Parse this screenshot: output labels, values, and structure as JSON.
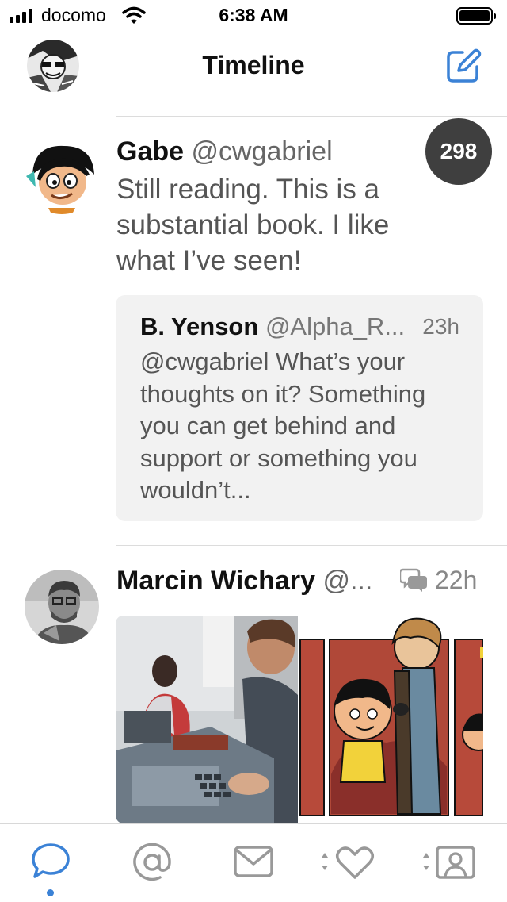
{
  "status_bar": {
    "carrier": "docomo",
    "time": "6:38 AM"
  },
  "nav": {
    "title": "Timeline"
  },
  "posts": [
    {
      "display_name": "Gabe",
      "handle": "@cwgabriel",
      "text": "Still reading. This is a substantial book. I like what I’ve seen!",
      "count_badge": "298",
      "quote": {
        "display_name": "B. Yenson",
        "handle": "@Alpha_R...",
        "time": "23h",
        "text": "@cwgabriel What’s your thoughts on it? Something you can get behind and support or something you wouldn’t..."
      }
    },
    {
      "display_name": "Marcin Wichary",
      "handle": "@...",
      "time": "22h"
    }
  ],
  "tabs": [
    {
      "name": "timeline",
      "icon": "speech-bubble-icon",
      "active": true
    },
    {
      "name": "mentions",
      "icon": "at-sign-icon"
    },
    {
      "name": "messages",
      "icon": "envelope-icon"
    },
    {
      "name": "favorites",
      "icon": "heart-icon"
    },
    {
      "name": "profile",
      "icon": "profile-card-icon"
    }
  ],
  "colors": {
    "accent": "#3b82d6",
    "badge": "#3f3f3f",
    "quote_bg": "#f2f2f2"
  }
}
